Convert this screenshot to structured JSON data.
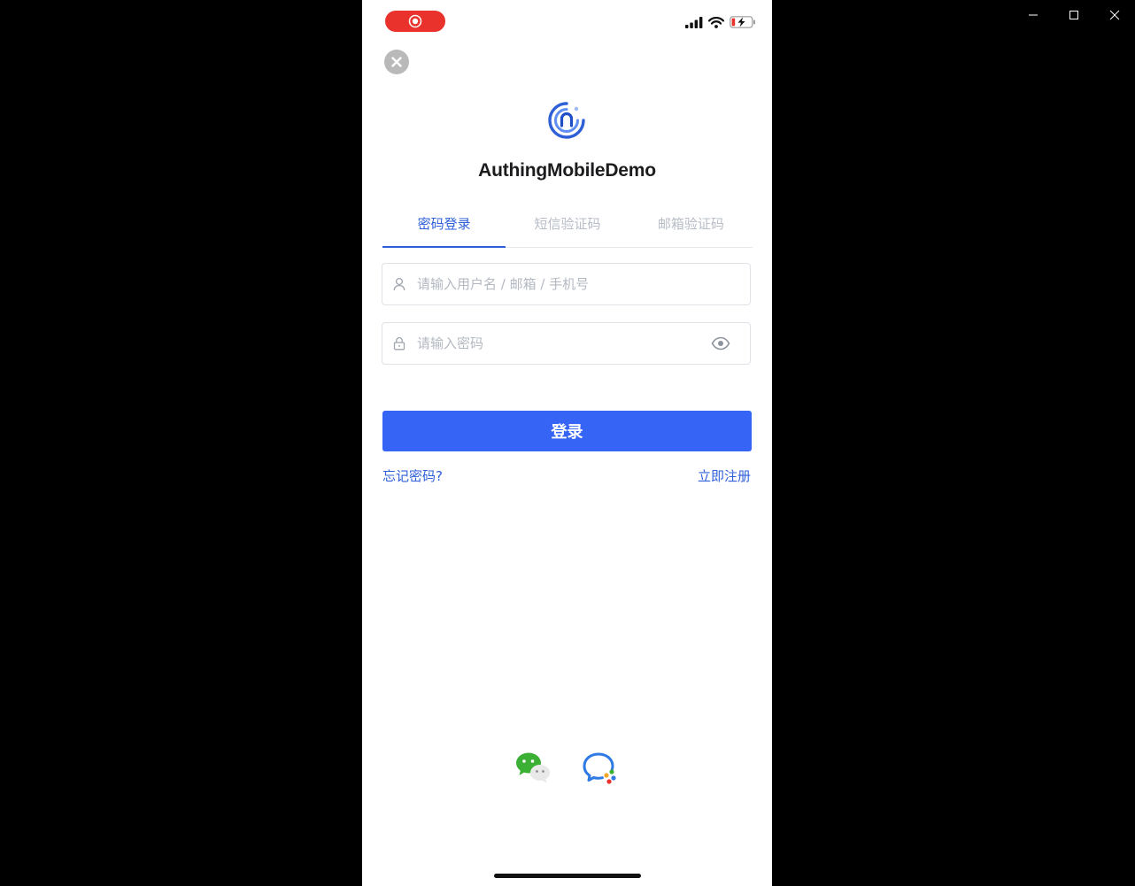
{
  "window": {
    "minimize_icon": "minimize-icon",
    "maximize_icon": "maximize-icon",
    "close_icon": "close-icon"
  },
  "status_bar": {
    "recording_icon": "screen-recording-icon",
    "signal_icon": "cellular-signal-icon",
    "wifi_icon": "wifi-icon",
    "battery_icon": "battery-charging-icon"
  },
  "app": {
    "title": "AuthingMobileDemo",
    "logo_icon": "authing-logo-icon",
    "accent_color": "#2f5fd9",
    "button_color": "#3664f4"
  },
  "tabs": [
    {
      "label": "密码登录",
      "active": true
    },
    {
      "label": "短信验证码",
      "active": false
    },
    {
      "label": "邮箱验证码",
      "active": false
    }
  ],
  "form": {
    "username_placeholder": "请输入用户名 / 邮箱 / 手机号",
    "username_value": "",
    "password_placeholder": "请输入密码",
    "password_value": "",
    "login_label": "登录",
    "forgot_label": "忘记密码?",
    "register_label": "立即注册"
  },
  "social": [
    {
      "name": "wechat",
      "icon": "wechat-icon"
    },
    {
      "name": "wecom",
      "icon": "wecom-icon"
    }
  ]
}
